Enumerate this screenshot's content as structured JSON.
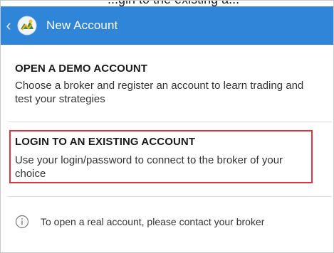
{
  "top_strip": {
    "text": "...gin to the existing a..."
  },
  "app_bar": {
    "back_icon": "chevron-left-icon",
    "logo_icon": "metatrader-logo-icon",
    "title": "New Account",
    "background_color": "#2f86d9"
  },
  "options": [
    {
      "title": "OPEN A DEMO ACCOUNT",
      "description": "Choose a broker and register an account to learn trading and test your strategies"
    },
    {
      "title": "LOGIN TO AN EXISTING ACCOUNT",
      "description": "Use your login/password to connect to the broker of your choice",
      "highlight_color": "#e2343f"
    }
  ],
  "info": {
    "icon": "info-circle-icon",
    "text": "To open a real account, please contact your broker"
  }
}
